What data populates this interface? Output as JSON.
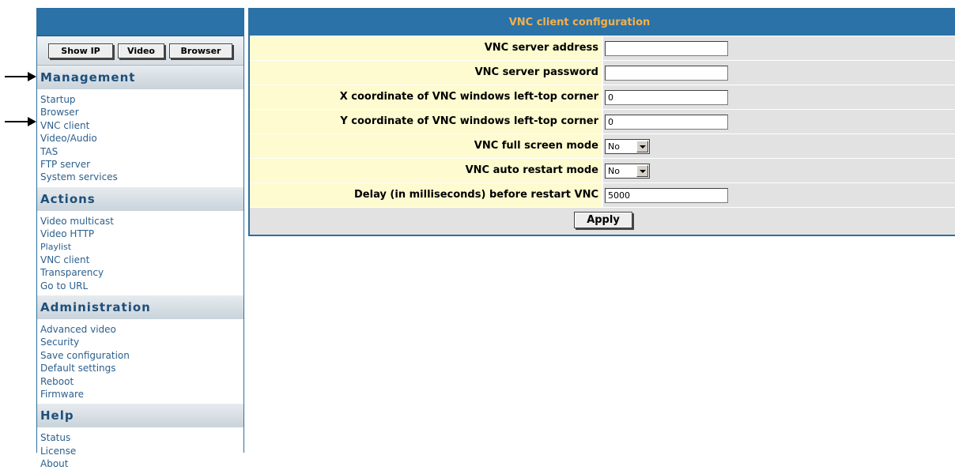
{
  "sidebar": {
    "buttons": {
      "show_ip": "Show IP",
      "video": "Video",
      "browser": "Browser"
    },
    "sections": [
      {
        "title": "Management",
        "items": [
          "Startup",
          "Browser",
          "VNC client",
          "Video/Audio",
          "TAS",
          "FTP server",
          "System services"
        ]
      },
      {
        "title": "Actions",
        "items": [
          "Video multicast",
          "Video HTTP",
          "Playlist",
          "VNC client",
          "Transparency",
          "Go to URL"
        ]
      },
      {
        "title": "Administration",
        "items": [
          "Advanced video",
          "Security",
          "Save configuration",
          "Default settings",
          "Reboot",
          "Firmware"
        ]
      },
      {
        "title": "Help",
        "items": [
          "Status",
          "License",
          "About"
        ]
      }
    ]
  },
  "panel": {
    "title": "VNC client configuration",
    "fields": [
      {
        "label": "VNC server address",
        "value": ""
      },
      {
        "label": "VNC server password",
        "value": ""
      },
      {
        "label": "X coordinate of VNC windows left-top corner",
        "value": "0"
      },
      {
        "label": "Y coordinate of VNC windows left-top corner",
        "value": "0"
      },
      {
        "label": "VNC full screen mode",
        "value": "No"
      },
      {
        "label": "VNC auto restart mode",
        "value": "No"
      },
      {
        "label": "Delay (in milliseconds) before restart VNC",
        "value": "5000"
      }
    ],
    "apply_label": "Apply"
  },
  "colors": {
    "header_blue": "#2a72a8",
    "title_text": "#f5b04a",
    "label_bg": "#fdfbcf",
    "link": "#2c5f8e"
  }
}
